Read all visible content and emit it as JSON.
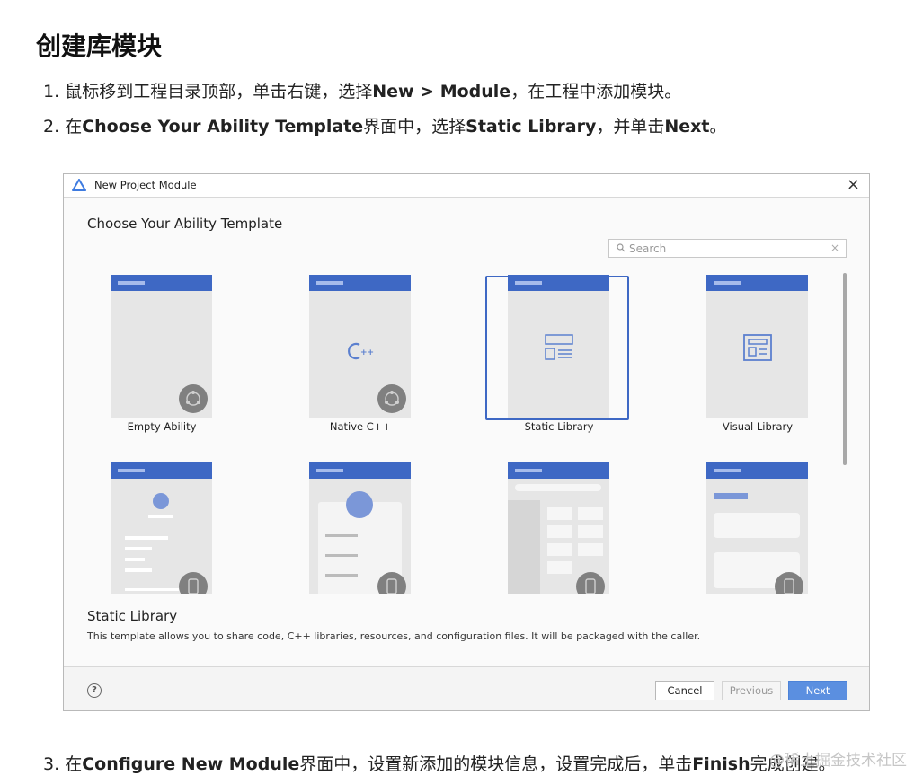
{
  "doc": {
    "title": "创建库模块",
    "step1": {
      "num": "1.",
      "a": "鼠标移到工程目录顶部，单击右键，选择",
      "b": "New > Module",
      "c": "，在工程中添加模块。"
    },
    "step2": {
      "num": "2.",
      "a": "在",
      "b": "Choose Your Ability Template",
      "c": "界面中，选择",
      "d": "Static Library",
      "e": "，并单击",
      "f": "Next",
      "g": "。"
    },
    "step3": {
      "num": "3.",
      "a": "在",
      "b": "Configure New Module",
      "c": "界面中，设置新添加的模块信息，设置完成后，单击",
      "d": "Finish",
      "e": "完成创建。"
    }
  },
  "dialog": {
    "title": "New Project Module",
    "heading": "Choose Your Ability Template",
    "search_placeholder": "Search",
    "clear_glyph": "×",
    "close_glyph": "×",
    "templates": [
      {
        "label": "Empty Ability",
        "selected": false,
        "icon": "empty-ability"
      },
      {
        "label": "Native C++",
        "selected": false,
        "icon": "cpp"
      },
      {
        "label": "Static Library",
        "selected": true,
        "icon": "static-library"
      },
      {
        "label": "Visual Library",
        "selected": false,
        "icon": "visual-library"
      }
    ],
    "description_title": "Static Library",
    "description": "This template allows you to share code, C++ libraries, resources, and configuration files. It will be packaged with the caller.",
    "help_glyph": "?",
    "buttons": {
      "cancel": "Cancel",
      "previous": "Previous",
      "next": "Next"
    },
    "accent_color": "#3e68c4"
  },
  "watermark": "@稀土掘金技术社区"
}
